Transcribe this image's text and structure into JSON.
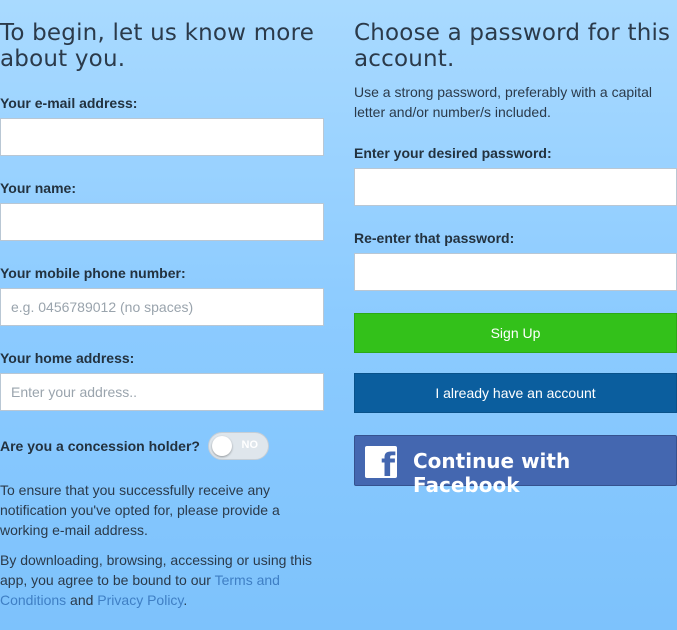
{
  "left": {
    "heading": "To begin, let us know more about you.",
    "email_label": "Your e-mail address:",
    "email_value": "",
    "name_label": "Your name:",
    "name_value": "",
    "phone_label": "Your mobile phone number:",
    "phone_placeholder": "e.g. 0456789012 (no spaces)",
    "address_label": "Your home address:",
    "address_placeholder": "Enter your address..",
    "concession_label": "Are you a concession holder?",
    "concession_toggle": "NO",
    "notice": "To ensure that you successfully receive any notification you've opted for, please provide a working e-mail address.",
    "terms_prefix": "By downloading, browsing, accessing or using this app, you agree to be bound to our ",
    "terms_link": "Terms and Conditions",
    "terms_and": " and ",
    "privacy_link": "Privacy Policy",
    "terms_suffix": "."
  },
  "right": {
    "heading": "Choose a password for this account.",
    "hint": "Use a strong password, preferably with a capital letter and/or number/s included.",
    "password_label": "Enter your desired password:",
    "reenter_label": "Re-enter that password:",
    "signup_button": "Sign Up",
    "existing_button": "I already have an account",
    "facebook_button": "Continue with Facebook",
    "facebook_icon": "f"
  },
  "colors": {
    "signup": "#33c11a",
    "existing": "#0b5e9e",
    "facebook": "#4467b0",
    "link": "#3f7fc4"
  }
}
